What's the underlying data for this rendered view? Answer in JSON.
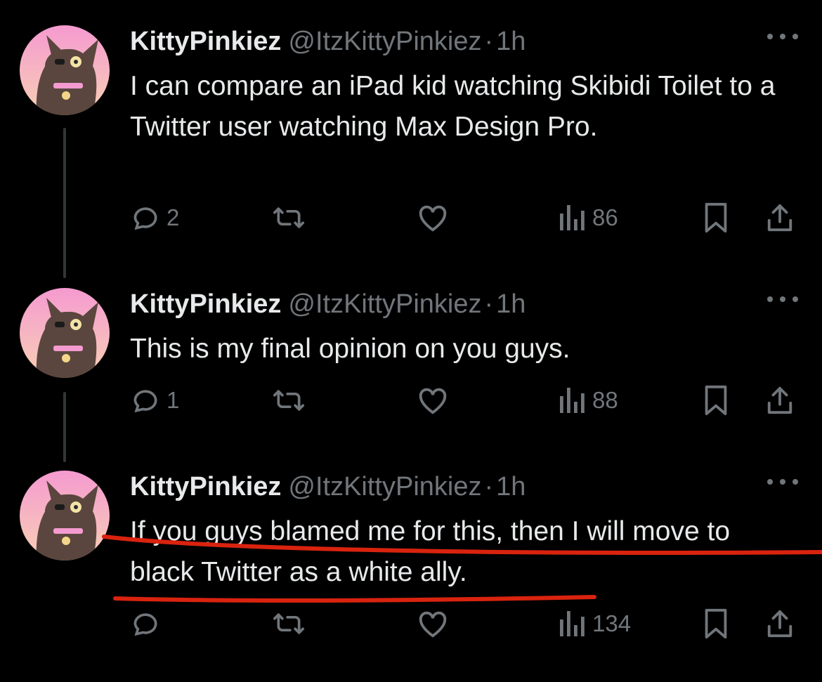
{
  "tweets": [
    {
      "name": "KittyPinkiez",
      "handle": "@ItzKittyPinkiez",
      "separator": "·",
      "time": "1h",
      "text": "I can compare an iPad kid watching Skibidi Toilet to a Twitter user watching Max Design Pro.",
      "replies": "2",
      "retweets": "",
      "likes": "",
      "views": "86"
    },
    {
      "name": "KittyPinkiez",
      "handle": "@ItzKittyPinkiez",
      "separator": "·",
      "time": "1h",
      "text": "This is my final opinion on you guys.",
      "replies": "1",
      "retweets": "",
      "likes": "",
      "views": "88"
    },
    {
      "name": "KittyPinkiez",
      "handle": "@ItzKittyPinkiez",
      "separator": "·",
      "time": "1h",
      "text": "If you guys blamed me for this, then I will move to black Twitter as a white ally.",
      "replies": "",
      "retweets": "",
      "likes": "",
      "views": "134"
    }
  ],
  "icons": {
    "reply": "reply-icon",
    "retweet": "retweet-icon",
    "like": "heart-icon",
    "views": "views-bar-chart-icon",
    "bookmark": "bookmark-icon",
    "share": "share-icon",
    "more": "more-dots-icon"
  },
  "colors": {
    "background": "#000000",
    "text": "#e7e9ea",
    "muted": "#71767b",
    "annotation": "#d9230f",
    "avatar_pink": "#f7a9d6",
    "avatar_peach": "#f7c9b6"
  }
}
